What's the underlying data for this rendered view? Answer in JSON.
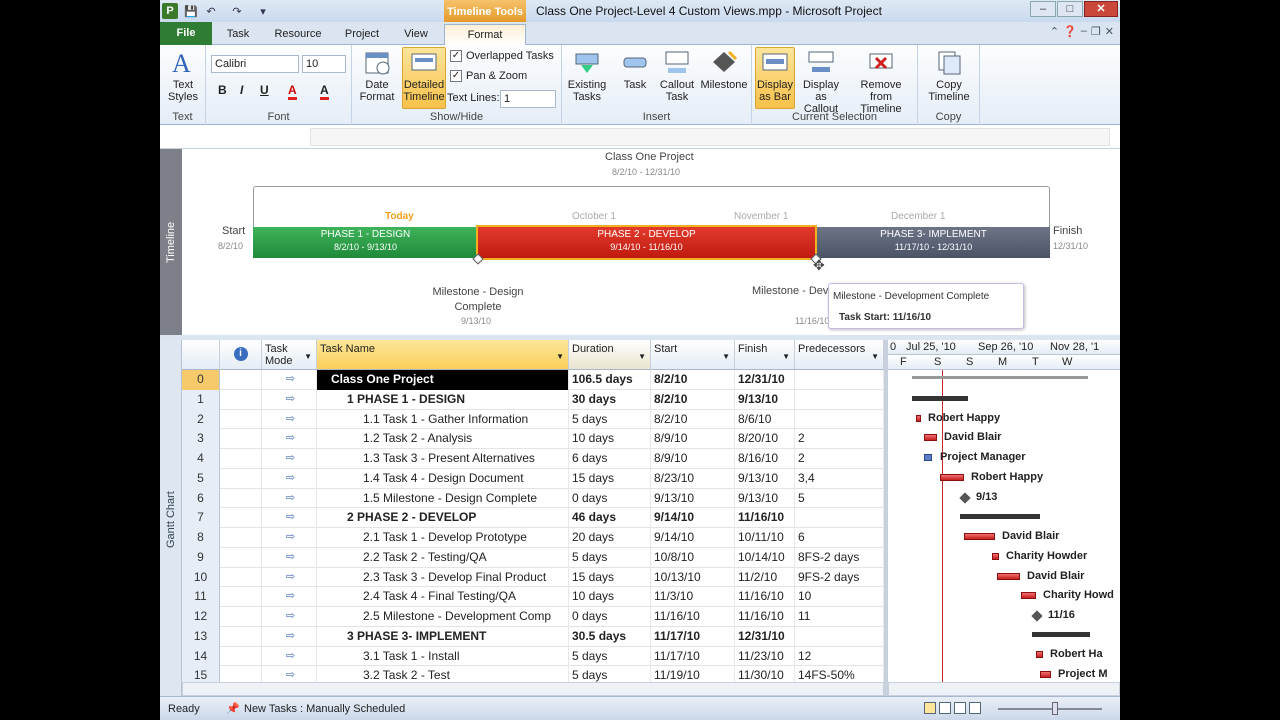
{
  "app": {
    "title": "Class One Project-Level 4 Custom Views.mpp  -  Microsoft Project",
    "contextual_tab_group": "Timeline Tools",
    "window_controls": {
      "minimize": "–",
      "maximize": "□",
      "close": "✕"
    }
  },
  "tabs": [
    "File",
    "Task",
    "Resource",
    "Project",
    "View",
    "Format"
  ],
  "ribbon": {
    "text_styles": {
      "label": "Text Styles",
      "group": "Text"
    },
    "font": {
      "name": "Calibri",
      "size": "10",
      "group": "Font",
      "bold": "B",
      "italic": "I",
      "underline": "U",
      "fill": "A",
      "color": "A"
    },
    "show_hide": {
      "date_format": "Date Format",
      "detailed_timeline": "Detailed Timeline",
      "overlapped_tasks": "Overlapped Tasks",
      "pan_zoom": "Pan & Zoom",
      "text_lines_label": "Text Lines:",
      "text_lines_value": "1",
      "group": "Show/Hide"
    },
    "insert": {
      "existing_tasks": "Existing Tasks",
      "task": "Task",
      "callout_task": "Callout Task",
      "milestone": "Milestone",
      "group": "Insert"
    },
    "current_selection": {
      "display_as_bar": "Display as Bar",
      "display_as_callout": "Display as Callout",
      "remove_from_timeline": "Remove from Timeline",
      "group": "Current Selection"
    },
    "copy": {
      "copy_timeline": "Copy Timeline",
      "group": "Copy"
    }
  },
  "timeline": {
    "side_label": "Timeline",
    "project_title": "Class One Project",
    "project_dates": "8/2/10 - 12/31/10",
    "start_label": "Start",
    "start_date": "8/2/10",
    "finish_label": "Finish",
    "finish_date": "12/31/10",
    "today": "Today",
    "months": [
      "October 1",
      "November 1",
      "December 1"
    ],
    "phases": [
      {
        "name": "PHASE 1 - DESIGN",
        "dates": "8/2/10 - 9/13/10",
        "color": "#1f8a3a"
      },
      {
        "name": "PHASE 2 - DEVELOP",
        "dates": "9/14/10 - 11/16/10",
        "color": "#c01a10"
      },
      {
        "name": "PHASE 3- IMPLEMENT",
        "dates": "11/17/10 - 12/31/10",
        "color": "#4b5366"
      }
    ],
    "milestone1": {
      "name": "Milestone - Design Complete",
      "date": "9/13/10"
    },
    "milestone2": {
      "name": "Milestone - Development Complete",
      "date": "11/16/10"
    },
    "tooltip": {
      "title": "Milestone - Development Complete",
      "detail": "Task Start: 11/16/10"
    }
  },
  "gantt": {
    "side_label": "Gantt Chart",
    "columns": [
      "Task Mode",
      "Task Name",
      "Duration",
      "Start",
      "Finish",
      "Predecessors"
    ],
    "rows": [
      {
        "id": "0",
        "name": "Class One Project",
        "duration": "106.5 days",
        "start": "8/2/10",
        "finish": "12/31/10",
        "pred": "",
        "level": 0
      },
      {
        "id": "1",
        "name": "1 PHASE 1 - DESIGN",
        "duration": "30 days",
        "start": "8/2/10",
        "finish": "9/13/10",
        "pred": "",
        "level": 1
      },
      {
        "id": "2",
        "name": "1.1 Task  1 - Gather Information",
        "duration": "5 days",
        "start": "8/2/10",
        "finish": "8/6/10",
        "pred": "",
        "level": 2
      },
      {
        "id": "3",
        "name": "1.2 Task 2 - Analysis",
        "duration": "10 days",
        "start": "8/9/10",
        "finish": "8/20/10",
        "pred": "2",
        "level": 2
      },
      {
        "id": "4",
        "name": "1.3 Task 3 - Present Alternatives",
        "duration": "6 days",
        "start": "8/9/10",
        "finish": "8/16/10",
        "pred": "2",
        "level": 2
      },
      {
        "id": "5",
        "name": "1.4 Task 4 - Design Document",
        "duration": "15 days",
        "start": "8/23/10",
        "finish": "9/13/10",
        "pred": "3,4",
        "level": 2
      },
      {
        "id": "6",
        "name": "1.5 Milestone - Design Complete",
        "duration": "0 days",
        "start": "9/13/10",
        "finish": "9/13/10",
        "pred": "5",
        "level": 2
      },
      {
        "id": "7",
        "name": "2 PHASE 2 - DEVELOP",
        "duration": "46 days",
        "start": "9/14/10",
        "finish": "11/16/10",
        "pred": "",
        "level": 1
      },
      {
        "id": "8",
        "name": "2.1 Task 1 - Develop Prototype",
        "duration": "20 days",
        "start": "9/14/10",
        "finish": "10/11/10",
        "pred": "6",
        "level": 2
      },
      {
        "id": "9",
        "name": "2.2 Task 2 - Testing/QA",
        "duration": "5 days",
        "start": "10/8/10",
        "finish": "10/14/10",
        "pred": "8FS-2 days",
        "level": 2
      },
      {
        "id": "10",
        "name": "2.3 Task 3 - Develop Final Product",
        "duration": "15 days",
        "start": "10/13/10",
        "finish": "11/2/10",
        "pred": "9FS-2 days",
        "level": 2
      },
      {
        "id": "11",
        "name": "2.4 Task 4 - Final Testing/QA",
        "duration": "10 days",
        "start": "11/3/10",
        "finish": "11/16/10",
        "pred": "10",
        "level": 2
      },
      {
        "id": "12",
        "name": "2.5 Milestone - Development Comp",
        "duration": "0 days",
        "start": "11/16/10",
        "finish": "11/16/10",
        "pred": "11",
        "level": 2
      },
      {
        "id": "13",
        "name": "3 PHASE 3- IMPLEMENT",
        "duration": "30.5 days",
        "start": "11/17/10",
        "finish": "12/31/10",
        "pred": "",
        "level": 1
      },
      {
        "id": "14",
        "name": "3.1 Task 1 - Install",
        "duration": "5 days",
        "start": "11/17/10",
        "finish": "11/23/10",
        "pred": "12",
        "level": 2
      },
      {
        "id": "15",
        "name": "3.2 Task 2 - Test",
        "duration": "5 days",
        "start": "11/19/10",
        "finish": "11/30/10",
        "pred": "14FS-50%",
        "level": 2
      }
    ],
    "timescale_top": [
      "0",
      "Jul 25, '10",
      "Sep 26, '10",
      "Nov 28, '1"
    ],
    "timescale_bottom": [
      "F",
      "S",
      "S",
      "M",
      "T",
      "W"
    ],
    "bar_labels": [
      "Robert Happy",
      "David Blair",
      "Project Manager",
      "Robert Happy",
      "9/13",
      "David Blair",
      "Charity Howder",
      "David Blair",
      "Charity Howd",
      "11/16",
      "Robert Ha",
      "Project M"
    ]
  },
  "status": {
    "ready": "Ready",
    "new_tasks": "New Tasks : Manually Scheduled"
  }
}
